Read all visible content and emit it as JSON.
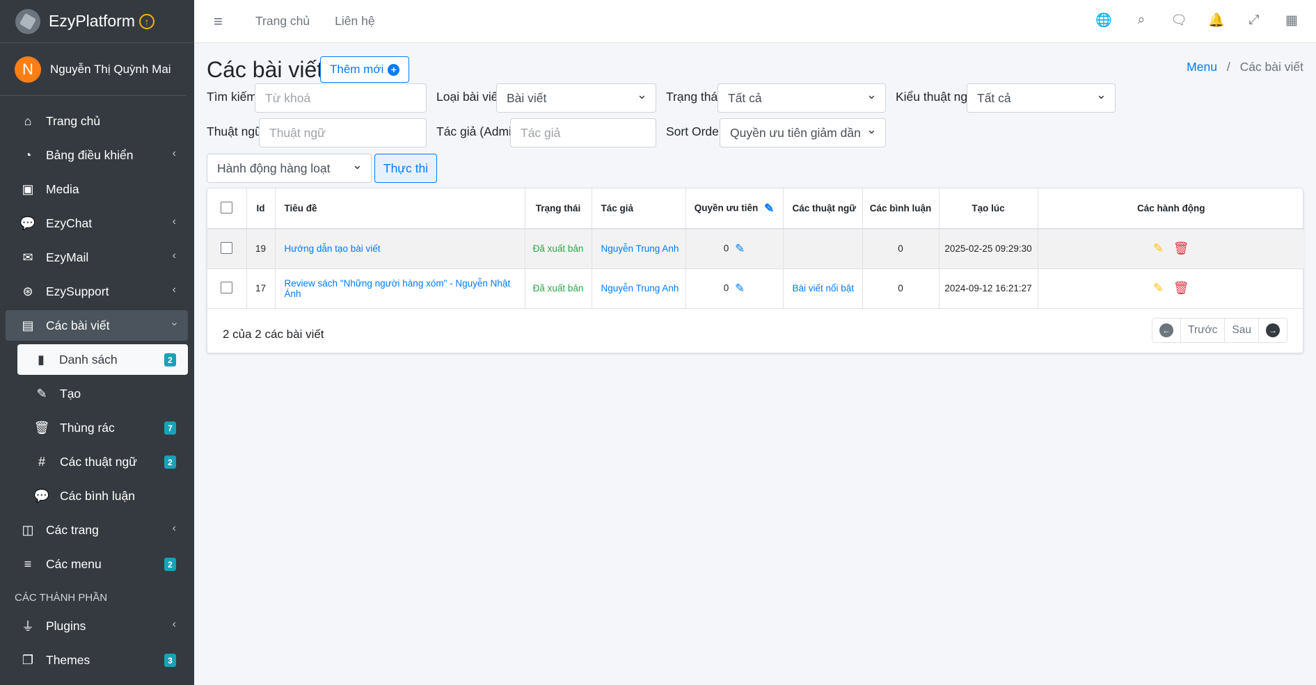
{
  "brand": {
    "name": "EzyPlatform",
    "up_glyph": "↑"
  },
  "user": {
    "initial": "N",
    "name": "Nguyễn Thị Quỳnh Mai"
  },
  "sidebar": {
    "items": [
      {
        "label": "Trang chủ"
      },
      {
        "label": "Bảng điều khiển"
      },
      {
        "label": "Media"
      },
      {
        "label": "EzyChat"
      },
      {
        "label": "EzyMail"
      },
      {
        "label": "EzySupport"
      },
      {
        "label": "Các bài viết"
      },
      {
        "label": "Danh sách",
        "badge": "2"
      },
      {
        "label": "Tạo"
      },
      {
        "label": "Thùng rác",
        "badge": "7"
      },
      {
        "label": "Các thuật ngữ",
        "badge": "2"
      },
      {
        "label": "Các bình luận"
      },
      {
        "label": "Các trang"
      },
      {
        "label": "Các menu",
        "badge": "2"
      },
      {
        "label": "Plugins"
      },
      {
        "label": "Themes",
        "badge": "3"
      }
    ],
    "section_header": "CÁC THÀNH PHẦN"
  },
  "topbar": {
    "links": [
      "Trang chủ",
      "Liên hệ"
    ],
    "icons": [
      "globe-icon",
      "search-icon",
      "chat-icon",
      "bell-icon",
      "fullscreen-icon",
      "apps-grid-icon"
    ]
  },
  "page": {
    "title": "Các bài viết",
    "add_button": "Thêm mới",
    "breadcrumb": {
      "link": "Menu",
      "sep": "/",
      "current": "Các bài viết"
    }
  },
  "filters": {
    "search_label": "Tìm kiếm:",
    "search_placeholder": "Từ khoá",
    "type_label": "Loại bài viết:",
    "type_value": "Bài viết",
    "status_label": "Trạng thái:",
    "status_value": "Tất cả",
    "term_type_label": "Kiểu thuật ngữ:",
    "term_type_value": "Tất cả",
    "term_label": "Thuật ngữ:",
    "term_placeholder": "Thuật ngữ",
    "author_label": "Tác giả (Admin):",
    "author_placeholder": "Tác giả",
    "sort_label": "Sort Order:",
    "sort_value": "Quyền ưu tiên giảm dần",
    "bulk_value": "Hành động hàng loạt",
    "run_button": "Thực thi"
  },
  "table": {
    "headers": {
      "id": "Id",
      "title": "Tiêu đề",
      "status": "Trạng thái",
      "author": "Tác giả",
      "priority": "Quyền ưu tiên",
      "terms": "Các thuật ngữ",
      "comments": "Các bình luận",
      "created": "Tạo lúc",
      "actions": "Các hành động"
    },
    "rows": [
      {
        "id": "19",
        "title": "Hướng dẫn tạo bài viết",
        "status": "Đã xuất bản",
        "author": "Nguyễn Trung Anh",
        "priority": "0",
        "terms": "",
        "comments": "0",
        "created": "2025-02-25 09:29:30"
      },
      {
        "id": "17",
        "title": "Review sách \"Những người hàng xóm\" - Nguyễn Nhật Ánh",
        "status": "Đã xuất bản",
        "author": "Nguyễn Trung Anh",
        "priority": "0",
        "terms": "Bài viết nổi bật",
        "comments": "0",
        "created": "2024-09-12 16:21:27"
      }
    ],
    "summary": "2 của 2 các bài viết",
    "pager": {
      "prev": "Trước",
      "next": "Sau"
    }
  },
  "colors": {
    "primary": "#007bff",
    "sidebar_bg": "#343a40",
    "success": "#28a745",
    "danger": "#dc3545",
    "warning": "#ffc107",
    "badge": "#17a2b8",
    "avatar": "#fd7e14"
  }
}
